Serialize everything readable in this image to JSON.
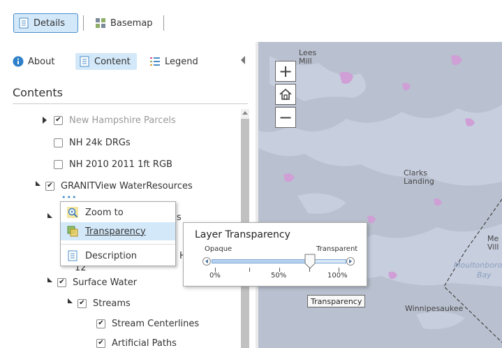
{
  "toolbar": {
    "details_label": "Details",
    "basemap_label": "Basemap"
  },
  "panel": {
    "tabs": {
      "about": "About",
      "content": "Content",
      "legend": "Legend"
    },
    "title": "Contents",
    "layers": [
      {
        "label": "New Hampshire Parcels",
        "checked": true
      },
      {
        "label": "NH 24k DRGs",
        "checked": false
      },
      {
        "label": "NH 2010 2011 1ft RGB",
        "checked": false
      },
      {
        "label": "GRANITView WaterResources",
        "checked": true
      },
      {
        "label": "Surface Water",
        "checked": true
      },
      {
        "label": "Streams",
        "checked": true
      },
      {
        "label": "Stream Centerlines",
        "checked": true
      },
      {
        "label": "Artificial Paths",
        "checked": true
      }
    ],
    "hidden_fragments": {
      "s": "s",
      "h": "H",
      "twelve": "12"
    },
    "ellipsis": "•••",
    "context_menu": {
      "zoom_to": "Zoom to",
      "transparency": "Transparency",
      "description": "Description"
    }
  },
  "map": {
    "zoom_in": "+",
    "zoom_out": "−",
    "labels": {
      "lees_mill": "Lees\nMill",
      "clarks_landing": "Clarks\nLanding",
      "winnipesaukee": "Winnipesaukee",
      "me_vill": "Me\nVill",
      "moultonboro": "Moultonboro",
      "bay": "Bay"
    }
  },
  "transparency_popup": {
    "title": "Layer Transparency",
    "opaque": "Opaque",
    "transparent": "Transparent",
    "ticks": [
      "0%",
      "50%",
      "100%"
    ],
    "value_fraction": 0.73
  },
  "tooltip": "Transparency",
  "colors": {
    "accent": "#4a8ec9",
    "selected_bg": "#d3e8f9",
    "map_land": "#b9c0cf",
    "map_water": "#c7cede",
    "map_pink": "#cf9fd6"
  }
}
